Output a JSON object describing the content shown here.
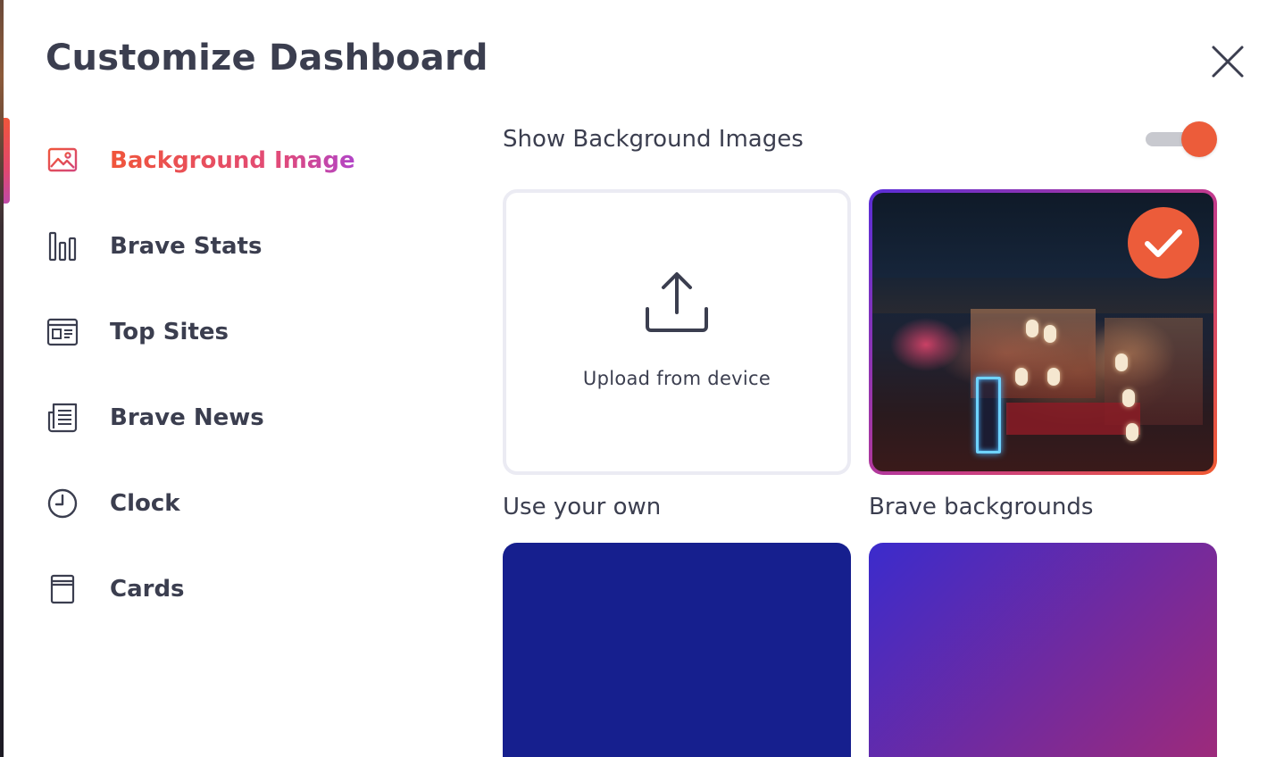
{
  "dialog": {
    "title": "Customize Dashboard",
    "close_icon": "close-icon"
  },
  "sidebar": {
    "active_index": 0,
    "items": [
      {
        "label": "Background Image",
        "icon": "image-icon"
      },
      {
        "label": "Brave Stats",
        "icon": "bar-chart-icon"
      },
      {
        "label": "Top Sites",
        "icon": "top-sites-icon"
      },
      {
        "label": "Brave News",
        "icon": "news-icon"
      },
      {
        "label": "Clock",
        "icon": "clock-icon"
      },
      {
        "label": "Cards",
        "icon": "cards-icon"
      }
    ]
  },
  "background_settings": {
    "show_background_label": "Show Background Images",
    "show_background_enabled": true,
    "upload_card": {
      "label": "Upload from device",
      "icon": "upload-icon",
      "caption": "Use your own"
    },
    "brave_card": {
      "caption": "Brave backgrounds",
      "selected": true,
      "badge_icon": "checkmark-icon"
    },
    "color_swatches": [
      {
        "color": "#161f8e"
      },
      {
        "gradient_from": "#3b2bcc",
        "gradient_to": "#a02a78"
      }
    ]
  },
  "colors": {
    "accent": "#ec5c3a",
    "text": "#3b3e4f",
    "active_gradient_start": "#f0553a",
    "active_gradient_end": "#b144c8"
  }
}
